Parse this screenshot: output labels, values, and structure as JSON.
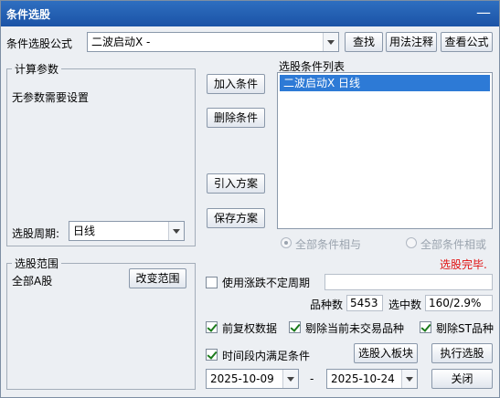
{
  "window": {
    "title": "条件选股",
    "close_glyph": "—"
  },
  "formula": {
    "label": "条件选股公式",
    "value": "二波启动X  -",
    "find_label": "查找",
    "usage_label": "用法注释",
    "view_label": "查看公式"
  },
  "params": {
    "group_label": "计算参数",
    "message": "无参数需要设置",
    "period_label": "选股周期:",
    "period_value": "日线"
  },
  "actions": {
    "add_label": "加入条件",
    "delete_label": "删除条件",
    "import_label": "引入方案",
    "save_label": "保存方案"
  },
  "conditions": {
    "list_label": "选股条件列表",
    "items": [
      "二波启动X  日线"
    ]
  },
  "logic": {
    "and_label": "全部条件相与",
    "or_label": "全部条件相或",
    "status": "选股完毕."
  },
  "range": {
    "group_label": "选股范围",
    "value": "全部A股",
    "change_label": "改变范围"
  },
  "options": {
    "uncertain_label": "使用涨跌不定周期",
    "uncertain_value": "",
    "count_label": "品种数",
    "count_value": "5453",
    "selected_label": "选中数",
    "selected_value": "160/2.9%",
    "adj_label": "前复权数据",
    "exclude_untraded_label": "剔除当前未交易品种",
    "exclude_st_label": "剔除ST品种",
    "period_cond_label": "时间段内满足条件",
    "to_board_label": "选股入板块",
    "execute_label": "执行选股",
    "start_date": "2025-10-09",
    "date_sep": "-",
    "end_date": "2025-10-24",
    "close_label": "关闭"
  }
}
